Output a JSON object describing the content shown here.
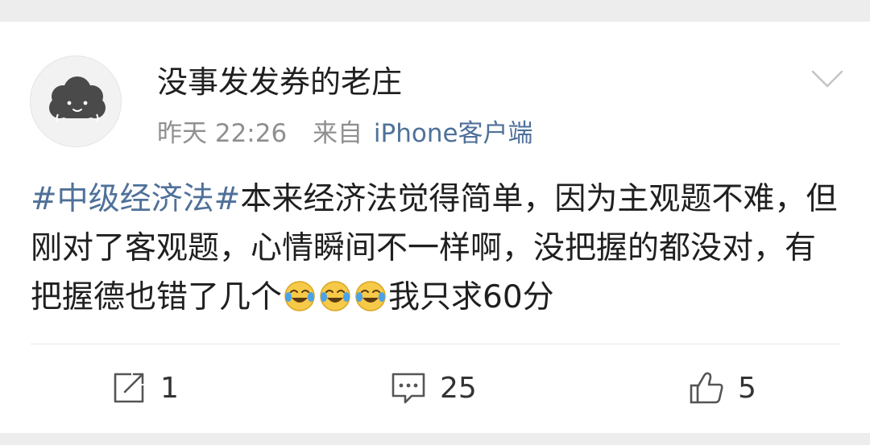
{
  "post": {
    "username": "没事发发券的老庄",
    "timestamp": "昨天 22:26",
    "source_label": "来自",
    "source_client": "iPhone客户端",
    "hashtag": "#中级经济法#",
    "content_part1": "本来经济法觉得简单，因为主观题不难，但刚对了客观题，心情瞬间不一样啊，没把握的都没对，有把握德也错了几个",
    "content_part2": "我只求60分",
    "emoji": "cry-laughing-emoji",
    "emoji_count": 3
  },
  "actions": {
    "repost_count": "1",
    "comment_count": "25",
    "like_count": "5"
  },
  "icons": {
    "avatar": "cloud-avatar",
    "menu": "chevron-down-icon",
    "repost": "repost-icon",
    "comment": "comment-icon",
    "like": "thumbs-up-icon"
  },
  "colors": {
    "link": "#4f7199",
    "text": "#1f1f1f",
    "meta": "#8f8f8f",
    "background": "#ededed"
  }
}
